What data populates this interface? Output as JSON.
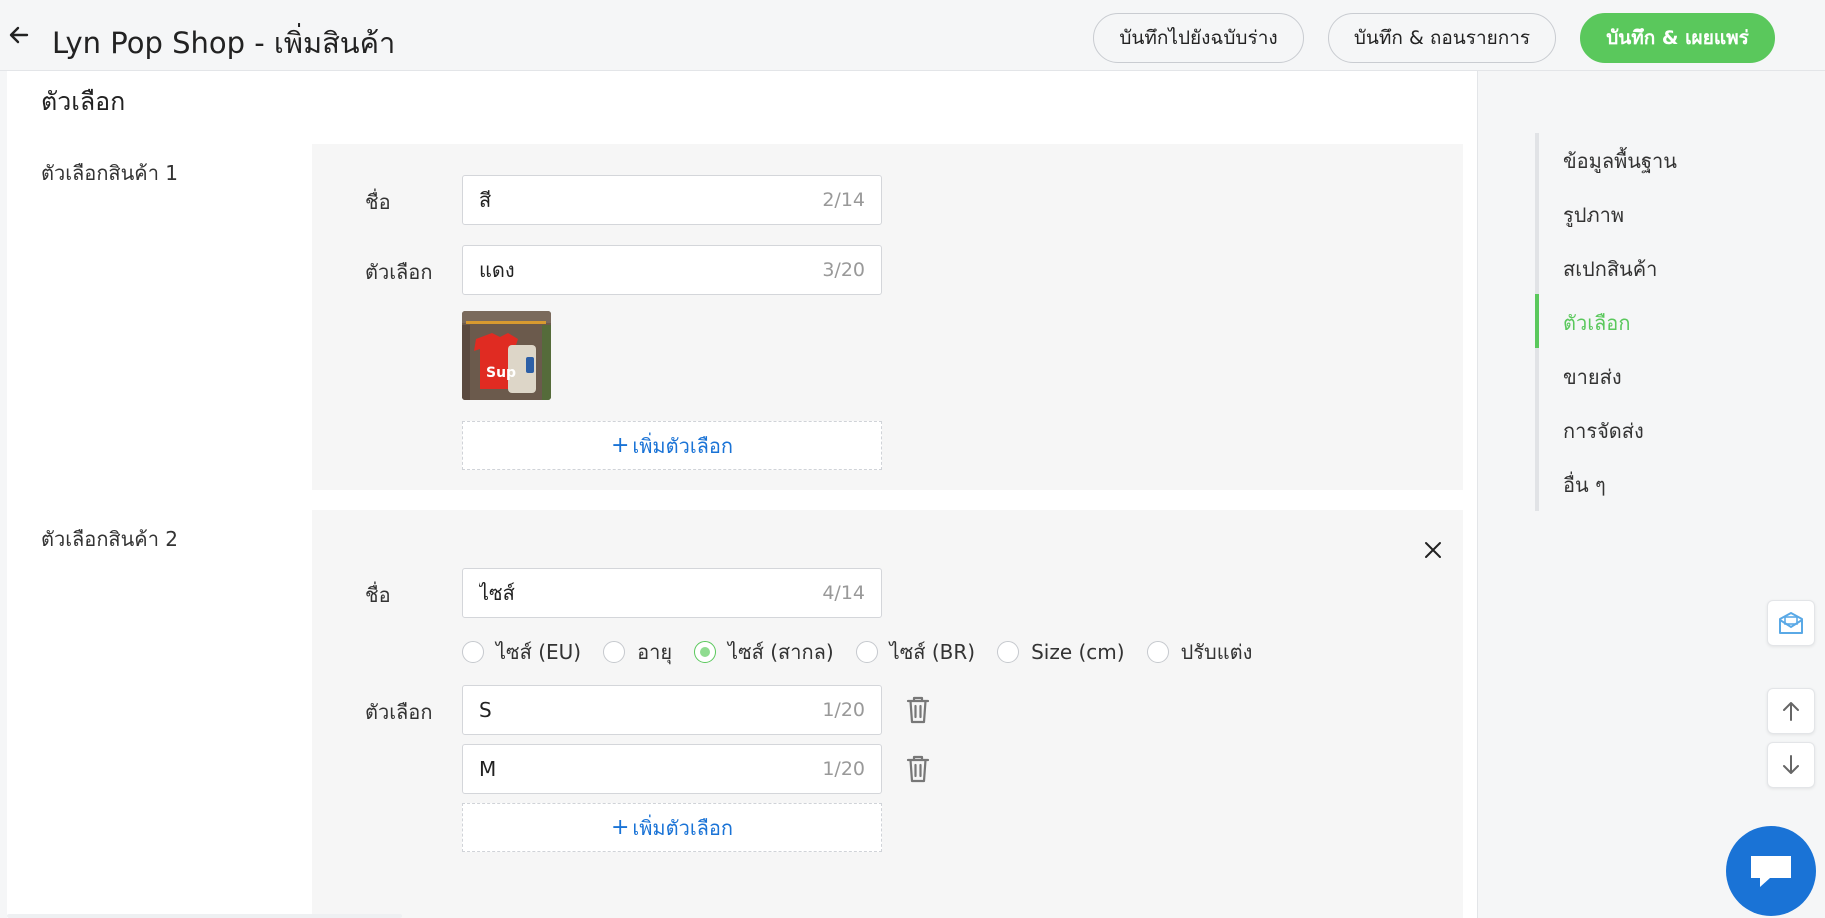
{
  "header": {
    "title": "Lyn Pop Shop - เพิ่มสินค้า",
    "save_draft_label": "บันทึกไปยังฉบับร่าง",
    "save_delist_label": "บันทึก & ถอนรายการ",
    "save_publish_label": "บันทึก & เผยแพร่"
  },
  "section": {
    "title": "ตัวเลือก"
  },
  "variation1": {
    "label": "ตัวเลือกสินค้า 1",
    "name_label": "ชื่อ",
    "name_value": "สี",
    "name_count": "2/14",
    "option_label": "ตัวเลือก",
    "option_value": "แดง",
    "option_count": "3/20",
    "add_option": "เพิ่มตัวเลือก"
  },
  "variation2": {
    "label": "ตัวเลือกสินค้า 2",
    "name_label": "ชื่อ",
    "name_value": "ไซส์",
    "name_count": "4/14",
    "size_types": [
      {
        "label": "ไซส์ (EU)",
        "selected": false
      },
      {
        "label": "อายุ",
        "selected": false
      },
      {
        "label": "ไซส์ (สากล)",
        "selected": true
      },
      {
        "label": "ไซส์ (BR)",
        "selected": false
      },
      {
        "label": "Size (cm)",
        "selected": false
      },
      {
        "label": "ปรับแต่ง",
        "selected": false
      }
    ],
    "option_label": "ตัวเลือก",
    "options": [
      {
        "value": "S",
        "count": "1/20"
      },
      {
        "value": "M",
        "count": "1/20"
      }
    ],
    "add_option": "เพิ่มตัวเลือก"
  },
  "side_nav": {
    "items": [
      "ข้อมูลพื้นฐาน",
      "รูปภาพ",
      "สเปกสินค้า",
      "ตัวเลือก",
      "ขายส่ง",
      "การจัดส่ง",
      "อื่น ๆ"
    ],
    "active": "ตัวเลือก"
  },
  "icons": {
    "back": "arrow-left-icon",
    "close": "close-icon",
    "trash": "trash-icon",
    "mail": "mail-icon",
    "up": "arrow-up-icon",
    "down": "arrow-down-icon",
    "chat": "chat-icon"
  },
  "colors": {
    "accent": "#5ac85c",
    "link": "#1a73d6"
  }
}
